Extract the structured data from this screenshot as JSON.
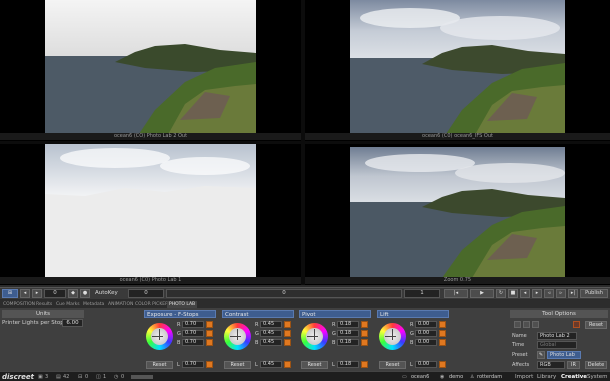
{
  "colors": {
    "accent_blue": "#3e5d8f",
    "slider_orange": "#e07820",
    "panel_bg": "#3f3f3f",
    "status_bg": "#1e1e1e"
  },
  "viewports": [
    {
      "caption": "ocean6 (CO) Photo Lab 2 Out"
    },
    {
      "caption": "ocean6 (C0) ocean6_IFS Out"
    },
    {
      "caption": "ocean6 (C0) Photo Lab 1"
    },
    {
      "caption": "Zoom 0.75"
    }
  ],
  "timeline": {
    "left_field": "0",
    "autokey_label": "AutoKey",
    "frame_field": "0",
    "center_value": "0",
    "end_field": "1",
    "publish_label": "Publish"
  },
  "tabs": [
    "COMPOSITION",
    "Results",
    "Cue Marks",
    "Metadata",
    "ANIMATION",
    "COLOR PICKER",
    "PHOTO LAB"
  ],
  "units": {
    "title": "Units",
    "label": "Printer Lights per Stop",
    "value": "6.00"
  },
  "groups": [
    {
      "title": "Exposure - F-Stops",
      "rows": [
        {
          "l": "R",
          "v": "0.70"
        },
        {
          "l": "G",
          "v": "0.70"
        },
        {
          "l": "B",
          "v": "0.70"
        },
        {
          "l": "L",
          "v": "0.70"
        }
      ],
      "reset": "Reset"
    },
    {
      "title": "Contrast",
      "rows": [
        {
          "l": "R",
          "v": "0.45"
        },
        {
          "l": "G",
          "v": "0.45"
        },
        {
          "l": "B",
          "v": "0.45"
        },
        {
          "l": "L",
          "v": "0.45"
        }
      ],
      "reset": "Reset"
    },
    {
      "title": "Pivot",
      "rows": [
        {
          "l": "R",
          "v": "0.18"
        },
        {
          "l": "G",
          "v": "0.18"
        },
        {
          "l": "B",
          "v": "0.18"
        },
        {
          "l": "L",
          "v": "0.18"
        }
      ],
      "reset": "Reset"
    },
    {
      "title": "Lift",
      "rows": [
        {
          "l": "R",
          "v": "0.00"
        },
        {
          "l": "G",
          "v": "0.00"
        },
        {
          "l": "B",
          "v": "0.00"
        },
        {
          "l": "L",
          "v": "0.00"
        }
      ],
      "reset": "Reset"
    }
  ],
  "tool_options": {
    "title": "Tool Options",
    "reset": "Reset",
    "name_label": "Name",
    "name_value": "Photo Lab 2",
    "time_label": "Time",
    "time_value": "Global",
    "preset_label": "Preset",
    "preset_value": "Photo Lab",
    "affects_label": "Affects",
    "affects_value": "RGB",
    "ir_label": "IR",
    "delete_label": "Delete"
  },
  "status": {
    "brand": "discreet",
    "count_a": "3",
    "count_b": "42",
    "count_c": "0",
    "count_d": "1",
    "count_e": "0",
    "clip": "ocean6",
    "project": "demo",
    "user": "rotterdam",
    "nav": [
      "Import",
      "Library",
      "Creative",
      "System"
    ],
    "active_nav": "Creative"
  }
}
